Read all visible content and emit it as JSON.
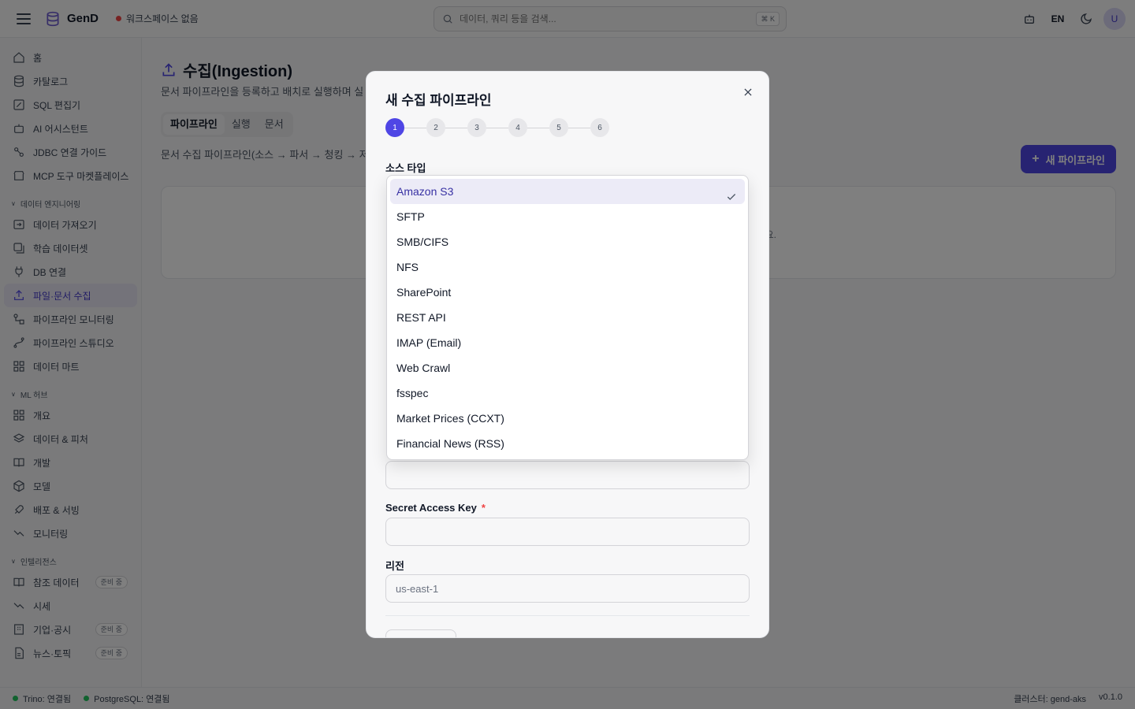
{
  "app": {
    "name": "GenD",
    "workspace": "워크스페이스 없음",
    "search_placeholder": "데이터, 쿼리 등을 검색...",
    "search_shortcut": "⌘ K",
    "lang": "EN",
    "avatar": "U"
  },
  "sidebar": {
    "top_items": [
      {
        "label": "홈",
        "icon": "home-icon"
      },
      {
        "label": "카탈로그",
        "icon": "database-icon"
      },
      {
        "label": "SQL 편집기",
        "icon": "edit-icon"
      },
      {
        "label": "AI 어시스턴트",
        "icon": "bot-icon"
      },
      {
        "label": "JDBC 연결 가이드",
        "icon": "link-icon"
      },
      {
        "label": "MCP 도구 마켓플레이스",
        "icon": "store-icon"
      }
    ],
    "section_de": "데이터 엔지니어링",
    "de_items": [
      {
        "label": "데이터 가져오기",
        "icon": "import-icon"
      },
      {
        "label": "학습 데이터셋",
        "icon": "images-icon"
      },
      {
        "label": "DB 연결",
        "icon": "plug-icon"
      },
      {
        "label": "파일·문서 수집",
        "icon": "upload-icon"
      },
      {
        "label": "파이프라인 모니터링",
        "icon": "workflow-icon"
      },
      {
        "label": "파이프라인 스튜디오",
        "icon": "spline-icon"
      },
      {
        "label": "데이터 마트",
        "icon": "grid-icon"
      }
    ],
    "section_ml": "ML 허브",
    "ml_items": [
      {
        "label": "개요",
        "icon": "grid-icon"
      },
      {
        "label": "데이터 & 피처",
        "icon": "layers-icon"
      },
      {
        "label": "개발",
        "icon": "book-icon"
      },
      {
        "label": "모델",
        "icon": "box-icon"
      },
      {
        "label": "배포 & 서빙",
        "icon": "rocket-icon"
      },
      {
        "label": "모니터링",
        "icon": "trend-icon"
      }
    ],
    "section_intel": "인텔리전스",
    "intel_items": [
      {
        "label": "참조 데이터",
        "icon": "book-icon",
        "badge": "준비 중"
      },
      {
        "label": "시세",
        "icon": "trend-icon"
      },
      {
        "label": "기업·공시",
        "icon": "building-icon",
        "badge": "준비 중"
      },
      {
        "label": "뉴스·토픽",
        "icon": "file-icon",
        "badge": "준비 중"
      }
    ]
  },
  "main": {
    "title": "수집(Ingestion)",
    "description": "문서 파이프라인을 등록하고 배치로 실행하며 실",
    "tabs": [
      "파이프라인",
      "실행",
      "문서"
    ],
    "flow_desc": "문서 수집 파이프라인(소스 → 파서 → 청킹 → 저",
    "new_button": "새 파이프라인",
    "empty_text": "요."
  },
  "modal": {
    "title": "새 수집 파이프라인",
    "steps": [
      "1",
      "2",
      "3",
      "4",
      "5",
      "6"
    ],
    "source_type_label": "소스 타입",
    "secret_key_label": "Secret Access Key",
    "required_mark": "*",
    "region_label": "리전",
    "region_placeholder": "us-east-1"
  },
  "dropdown": {
    "options": [
      "Amazon S3",
      "SFTP",
      "SMB/CIFS",
      "NFS",
      "SharePoint",
      "REST API",
      "IMAP (Email)",
      "Web Crawl",
      "fsspec",
      "Market Prices (CCXT)",
      "Financial News (RSS)"
    ],
    "selected": "Amazon S3"
  },
  "status": {
    "trino": "Trino: 연결됨",
    "postgres": "PostgreSQL: 연결됨",
    "cluster": "클러스터: gend-aks",
    "version": "v0.1.0"
  },
  "colors": {
    "accent": "#4f46e5",
    "status_ok": "#22c55e",
    "status_none": "#ef4444"
  }
}
